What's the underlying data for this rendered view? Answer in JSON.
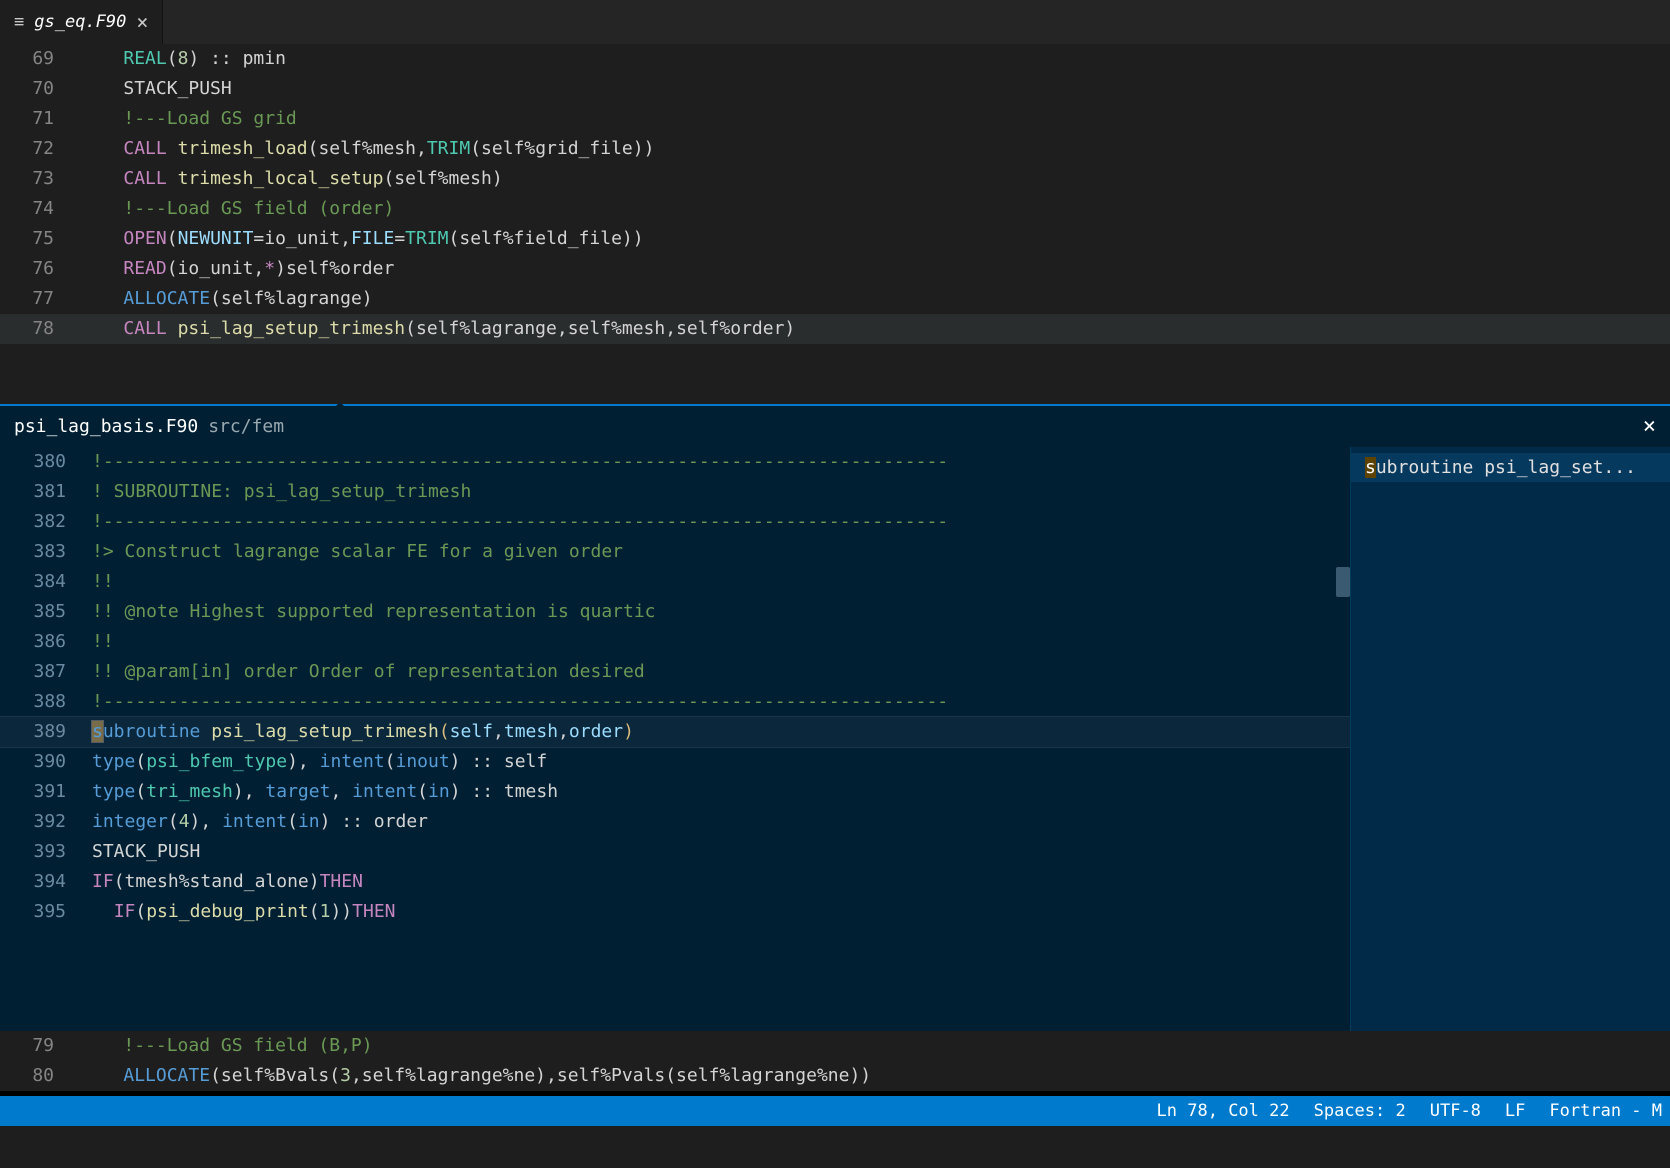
{
  "tab": {
    "filename": "gs_eq.F90"
  },
  "topEditor": {
    "lines": [
      {
        "n": 69,
        "tokens": [
          [
            "    ",
            "w"
          ],
          [
            "REAL",
            "type"
          ],
          [
            "(",
            "w"
          ],
          [
            "8",
            "num"
          ],
          [
            ")",
            "w"
          ],
          [
            " :: pmin",
            "w"
          ]
        ]
      },
      {
        "n": 70,
        "tokens": [
          [
            "    ",
            "w"
          ],
          [
            "STACK_PUSH",
            "w"
          ]
        ]
      },
      {
        "n": 71,
        "tokens": [
          [
            "    ",
            "w"
          ],
          [
            "!---Load GS grid",
            "comment"
          ]
        ]
      },
      {
        "n": 72,
        "tokens": [
          [
            "    ",
            "w"
          ],
          [
            "CALL",
            "keyword"
          ],
          [
            " ",
            "w"
          ],
          [
            "trimesh_load",
            "func"
          ],
          [
            "(self%mesh,",
            "w"
          ],
          [
            "TRIM",
            "type"
          ],
          [
            "(self%grid_file))",
            "w"
          ]
        ]
      },
      {
        "n": 73,
        "tokens": [
          [
            "    ",
            "w"
          ],
          [
            "CALL",
            "keyword"
          ],
          [
            " ",
            "w"
          ],
          [
            "trimesh_local_setup",
            "func"
          ],
          [
            "(self%mesh)",
            "w"
          ]
        ]
      },
      {
        "n": 74,
        "tokens": [
          [
            "    ",
            "w"
          ],
          [
            "!---Load GS field (order)",
            "comment"
          ]
        ]
      },
      {
        "n": 75,
        "tokens": [
          [
            "    ",
            "w"
          ],
          [
            "OPEN",
            "keyword"
          ],
          [
            "(",
            "w"
          ],
          [
            "NEWUNIT",
            "const"
          ],
          [
            "=io_unit,",
            "w"
          ],
          [
            "FILE",
            "const"
          ],
          [
            "=",
            "w"
          ],
          [
            "TRIM",
            "type"
          ],
          [
            "(self%field_file))",
            "w"
          ]
        ]
      },
      {
        "n": 76,
        "tokens": [
          [
            "    ",
            "w"
          ],
          [
            "READ",
            "keyword"
          ],
          [
            "(io_unit,",
            "w"
          ],
          [
            "*",
            "keyword"
          ],
          [
            ")self%order",
            "w"
          ]
        ]
      },
      {
        "n": 77,
        "tokens": [
          [
            "    ",
            "w"
          ],
          [
            "ALLOCATE",
            "blue"
          ],
          [
            "(self%lagrange)",
            "w"
          ]
        ]
      },
      {
        "n": 78,
        "hl": true,
        "tokens": [
          [
            "    ",
            "w"
          ],
          [
            "CALL",
            "keyword"
          ],
          [
            " ",
            "w"
          ],
          [
            "psi_lag_setup_trimesh",
            "func"
          ],
          [
            "(self%lagrange,self%mesh,self%order)",
            "w"
          ]
        ]
      }
    ]
  },
  "peek": {
    "filename": "psi_lag_basis.F90",
    "filepath": "src/fem",
    "sideItem": {
      "prefix": "s",
      "rest": "ubroutine psi_lag_set..."
    },
    "lines": [
      {
        "n": 380,
        "tokens": [
          [
            "!------------------------------------------------------------------------------",
            "comment"
          ]
        ]
      },
      {
        "n": 381,
        "tokens": [
          [
            "! SUBROUTINE: psi_lag_setup_trimesh",
            "comment"
          ]
        ]
      },
      {
        "n": 382,
        "tokens": [
          [
            "!------------------------------------------------------------------------------",
            "comment"
          ]
        ]
      },
      {
        "n": 383,
        "tokens": [
          [
            "!> Construct lagrange scalar FE for a given order",
            "comment"
          ]
        ]
      },
      {
        "n": 384,
        "tokens": [
          [
            "!!",
            "comment"
          ]
        ]
      },
      {
        "n": 385,
        "tokens": [
          [
            "!! @note Highest supported representation is quartic",
            "comment"
          ]
        ]
      },
      {
        "n": 386,
        "tokens": [
          [
            "!!",
            "comment"
          ]
        ]
      },
      {
        "n": 387,
        "tokens": [
          [
            "!! @param[in] order Order of representation desired",
            "comment"
          ]
        ]
      },
      {
        "n": 388,
        "tokens": [
          [
            "!------------------------------------------------------------------------------",
            "comment"
          ]
        ]
      },
      {
        "n": 389,
        "hl": true,
        "sel": true,
        "tokens": [
          [
            "s",
            "blue-sel"
          ],
          [
            "ubroutine",
            "blue"
          ],
          [
            " ",
            "w"
          ],
          [
            "psi_lag_setup_trimesh",
            "func"
          ],
          [
            "(",
            "gold"
          ],
          [
            "self",
            "const"
          ],
          [
            ",",
            "w"
          ],
          [
            "tmesh",
            "const"
          ],
          [
            ",",
            "w"
          ],
          [
            "order",
            "const"
          ],
          [
            ")",
            "gold"
          ]
        ]
      },
      {
        "n": 390,
        "tokens": [
          [
            "type",
            "blue"
          ],
          [
            "(",
            "w"
          ],
          [
            "psi_bfem_type",
            "type"
          ],
          [
            "), ",
            "w"
          ],
          [
            "intent",
            "blue"
          ],
          [
            "(",
            "w"
          ],
          [
            "inout",
            "blue"
          ],
          [
            ") :: self",
            "w"
          ]
        ]
      },
      {
        "n": 391,
        "tokens": [
          [
            "type",
            "blue"
          ],
          [
            "(",
            "w"
          ],
          [
            "tri_mesh",
            "type"
          ],
          [
            "), ",
            "w"
          ],
          [
            "target",
            "blue"
          ],
          [
            ", ",
            "w"
          ],
          [
            "intent",
            "blue"
          ],
          [
            "(",
            "w"
          ],
          [
            "in",
            "blue"
          ],
          [
            ") :: tmesh",
            "w"
          ]
        ]
      },
      {
        "n": 392,
        "tokens": [
          [
            "integer",
            "blue"
          ],
          [
            "(",
            "w"
          ],
          [
            "4",
            "num"
          ],
          [
            "), ",
            "w"
          ],
          [
            "intent",
            "blue"
          ],
          [
            "(",
            "w"
          ],
          [
            "in",
            "blue"
          ],
          [
            ") :: order",
            "w"
          ]
        ]
      },
      {
        "n": 393,
        "tokens": [
          [
            "STACK_PUSH",
            "w"
          ]
        ]
      },
      {
        "n": 394,
        "tokens": [
          [
            "IF",
            "keyword"
          ],
          [
            "(tmesh%stand_alone)",
            "w"
          ],
          [
            "THEN",
            "keyword"
          ]
        ]
      },
      {
        "n": 395,
        "tokens": [
          [
            "  ",
            "w"
          ],
          [
            "IF",
            "keyword"
          ],
          [
            "(",
            "w"
          ],
          [
            "psi_debug_print",
            "func"
          ],
          [
            "(",
            "w"
          ],
          [
            "1",
            "num"
          ],
          [
            "))",
            "w"
          ],
          [
            "THEN",
            "keyword"
          ]
        ]
      }
    ]
  },
  "bottomEditor": {
    "lines": [
      {
        "n": 79,
        "tokens": [
          [
            "    ",
            "w"
          ],
          [
            "!---Load GS field (B,P)",
            "comment"
          ]
        ]
      },
      {
        "n": 80,
        "tokens": [
          [
            "    ",
            "w"
          ],
          [
            "ALLOCATE",
            "blue"
          ],
          [
            "(self%Bvals(",
            "w"
          ],
          [
            "3",
            "num"
          ],
          [
            ",self%lagrange%ne),self%Pvals(self%lagrange%ne))",
            "w"
          ]
        ]
      }
    ]
  },
  "status": {
    "position": "Ln 78, Col 22",
    "spaces": "Spaces: 2",
    "encoding": "UTF-8",
    "eol": "LF",
    "language": "Fortran - M"
  }
}
